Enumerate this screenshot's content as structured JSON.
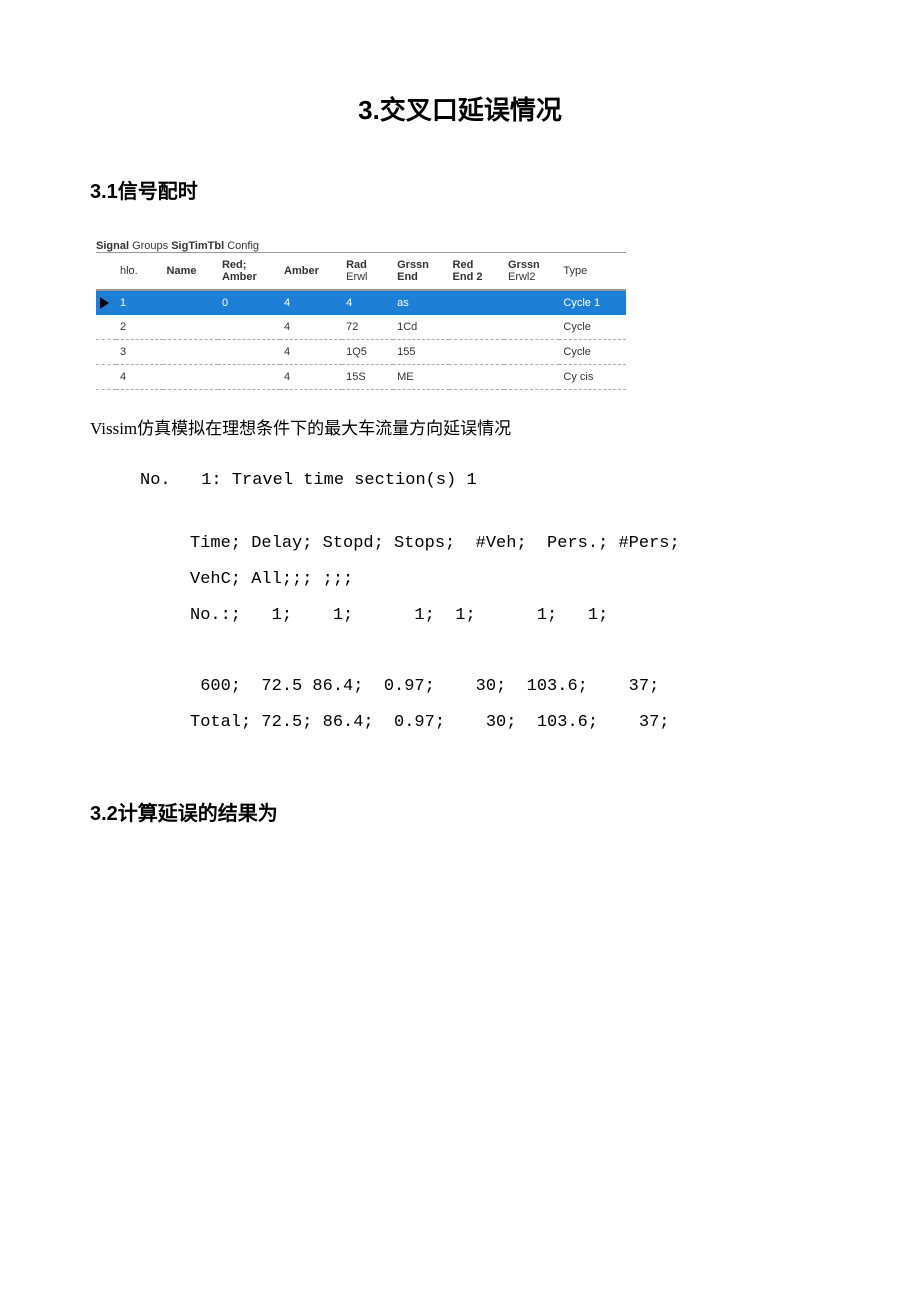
{
  "title": "3.交叉口延误情况",
  "section31": "3.1信号配时",
  "section32": "3.2计算延误的结果为",
  "sig_table": {
    "title_parts": {
      "a": "Signal",
      "b": " Groups ",
      "c": "SigTimTbl",
      "d": " Config"
    },
    "headers": {
      "hlo": "hlo.",
      "name": "Name",
      "red_amber_a": "Red;",
      "red_amber_b": "Amber",
      "amber": "Amber",
      "rad": "Rad",
      "erwl": "Erwl",
      "grssn": "Grssn",
      "end": "End",
      "red2": "Red",
      "end2": "End 2",
      "grssn2": "Grssn",
      "erwl2": "Erwl2",
      "type": "Type"
    },
    "rows": [
      {
        "sel": true,
        "n": "1",
        "name": "",
        "red_amber": "0",
        "amber": "4",
        "rad": "4",
        "grssn": "as",
        "red2": "",
        "grssn2": "",
        "type": "Cycle 1"
      },
      {
        "sel": false,
        "n": "2",
        "name": "",
        "red_amber": "",
        "amber": "4",
        "rad": "72",
        "grssn": "1Cd",
        "red2": "",
        "grssn2": "",
        "type": "Cycle"
      },
      {
        "sel": false,
        "n": "3",
        "name": "",
        "red_amber": "",
        "amber": "4",
        "rad": "1Q5",
        "grssn": "155",
        "red2": "",
        "grssn2": "",
        "type": "Cycle"
      },
      {
        "sel": false,
        "n": "4",
        "name": "",
        "red_amber": "",
        "amber": "4",
        "rad": "15S",
        "grssn": "ME",
        "red2": "",
        "grssn2": "",
        "type": "Cy cis"
      }
    ]
  },
  "body_line": "Vissim仿真模拟在理想条件下的最大车流量方向延误情况",
  "mono": {
    "line1": "No.   1: Travel time section(s) 1",
    "block": "Time; Delay; Stopd; Stops;  #Veh;  Pers.; #Pers;\nVehC; All;;; ;;;\nNo.:;   1;    1;      1;  1;      1;   1;\n\n 600;  72.5 86.4;  0.97;    30;  103.6;    37;\nTotal; 72.5; 86.4;  0.97;    30;  103.6;    37;"
  }
}
